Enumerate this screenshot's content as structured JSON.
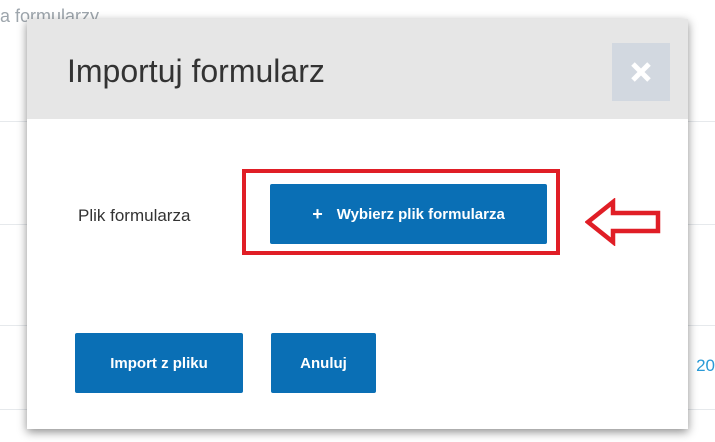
{
  "background": {
    "breadcrumb_text": "a formularzy",
    "partial_number": "20"
  },
  "modal": {
    "title": "Importuj formularz",
    "close_icon": "close-icon",
    "file_label": "Plik formularza",
    "choose_file": {
      "icon": "plus-icon",
      "plus_glyph": "+",
      "label": "Wybierz plik formularza"
    },
    "import_button_label": "Import z pliku",
    "cancel_button_label": "Anuluj"
  },
  "annotation": {
    "highlight_color": "#e01e26",
    "arrow_icon": "left-arrow-icon"
  },
  "colors": {
    "primary_button": "#0a6fb5",
    "header_bg": "#e6e6e6",
    "close_bg": "#d2d8e0"
  }
}
